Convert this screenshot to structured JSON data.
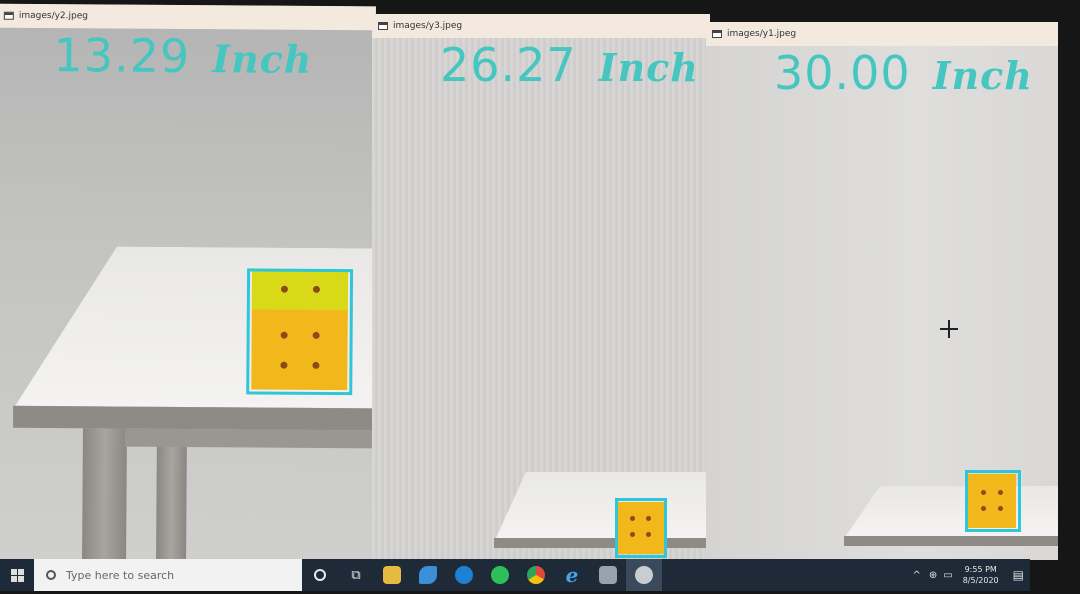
{
  "windows": [
    {
      "title": "images/y2.jpeg",
      "distance_value": "13.29",
      "distance_unit": "Inch"
    },
    {
      "title": "images/y3.jpeg",
      "distance_value": "26.27",
      "distance_unit": "Inch"
    },
    {
      "title": "images/y1.jpeg",
      "distance_value": "30.00",
      "distance_unit": "Inch"
    }
  ],
  "taskbar": {
    "search_placeholder": "Type here to search",
    "pinned_icons": [
      "cortana-icon",
      "task-view-icon",
      "file-explorer-icon",
      "app-icon",
      "edge-icon",
      "whatsapp-icon",
      "chrome-icon",
      "internet-explorer-icon",
      "app-icon-2",
      "app-icon-3"
    ],
    "clock_time": "9:55 PM",
    "clock_date": "8/5/2020"
  },
  "colors": {
    "overlay_text": "#45c6c0",
    "bbox": "#2fc6d6",
    "cube": "#f2b71a",
    "taskbar": "#1e2a37"
  }
}
